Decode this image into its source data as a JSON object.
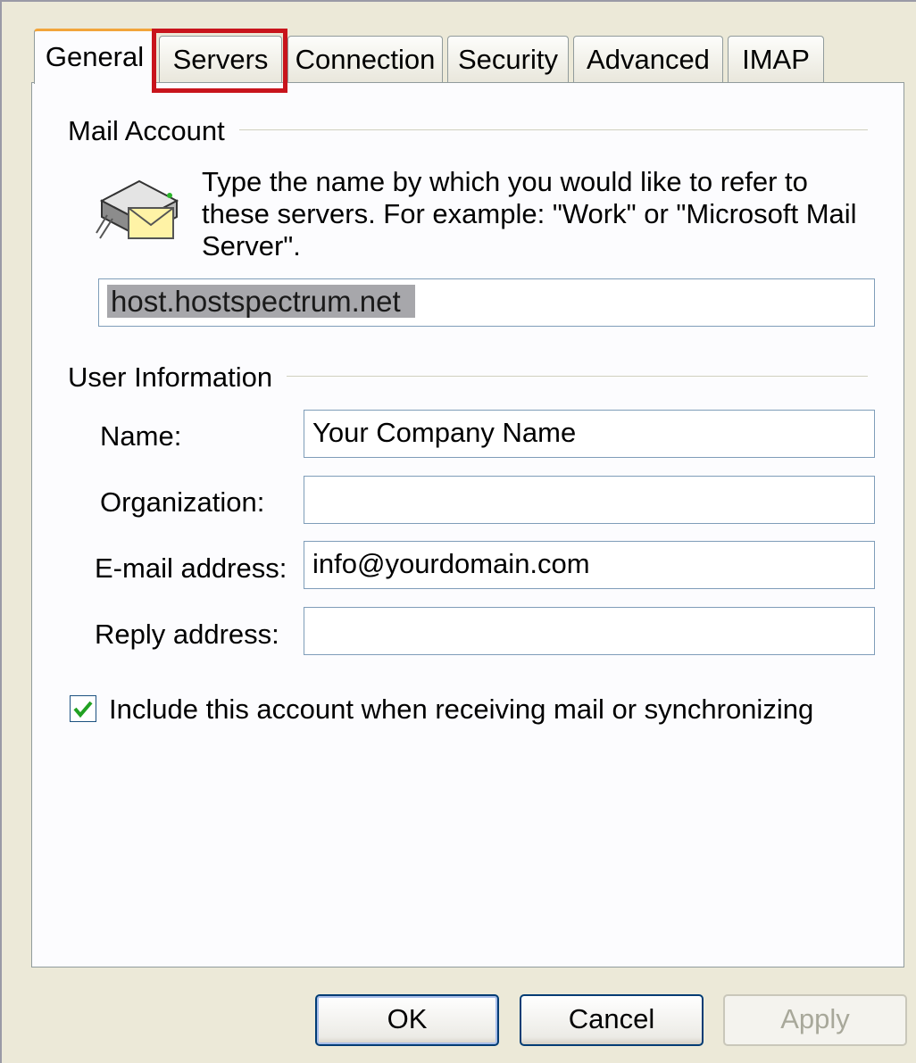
{
  "tabs": [
    {
      "label": "General"
    },
    {
      "label": "Servers"
    },
    {
      "label": "Connection"
    },
    {
      "label": "Security"
    },
    {
      "label": "Advanced"
    },
    {
      "label": "IMAP"
    }
  ],
  "mail_account": {
    "title": "Mail Account",
    "description": "Type the name by which you would like to refer to these servers.  For example: \"Work\" or \"Microsoft Mail Server\".",
    "account_name_value": "host.hostspectrum.net",
    "icon": "mail-server-icon"
  },
  "user_information": {
    "title": "User Information",
    "fields": [
      {
        "label": "Name:",
        "value": "Your Company Name"
      },
      {
        "label": "Organization:",
        "value": ""
      },
      {
        "label": "E-mail address:",
        "value": "info@yourdomain.com"
      },
      {
        "label": "Reply address:",
        "value": ""
      }
    ]
  },
  "include_account": {
    "label": "Include this account when receiving mail or synchronizing",
    "checked": true
  },
  "buttons": {
    "ok": "OK",
    "cancel": "Cancel",
    "apply": "Apply"
  },
  "colors": {
    "highlight_box": "#c8141c",
    "active_tab_accent": "#f2a53b",
    "checkmark": "#21a121"
  }
}
